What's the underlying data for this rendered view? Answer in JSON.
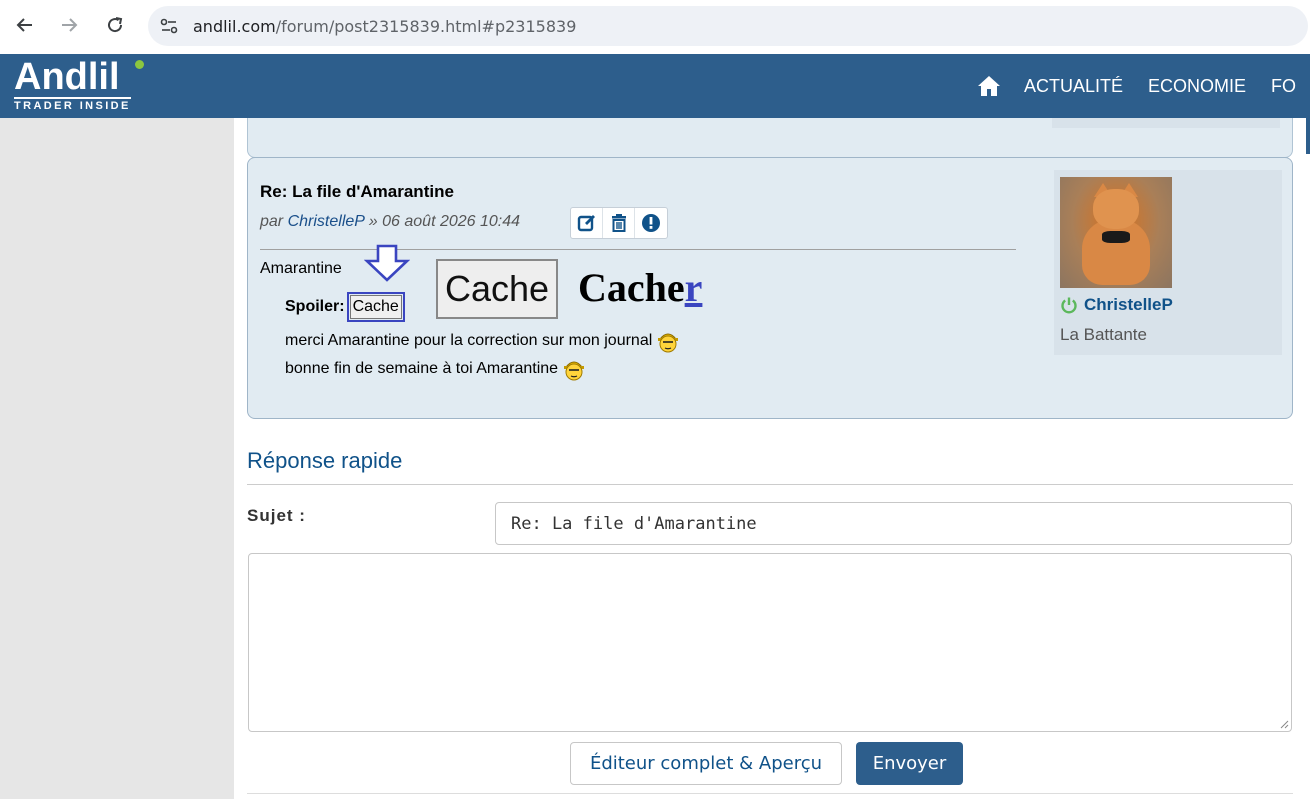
{
  "browser": {
    "url_host": "andlil.com",
    "url_path": "/forum/post2315839.html#p2315839"
  },
  "site": {
    "logo_main": "Andlil",
    "logo_sub": "TRADER INSIDE",
    "nav": [
      "ACTUALITÉ",
      "ECONOMIE",
      "FO"
    ]
  },
  "post": {
    "title": "Re: La file d'Amarantine",
    "meta_prefix": "par ",
    "author": "ChristelleP",
    "meta_date": " » 06 août 2026 10:44",
    "greeting": "Amarantine",
    "spoiler_label": "Spoiler:",
    "spoiler_button": "Cache",
    "big_button": "Cache",
    "serif_text": "Cache",
    "serif_last_letter": "r",
    "lines": [
      "merci Amarantine pour la correction sur mon journal",
      "bonne fin de semaine à toi Amarantine"
    ]
  },
  "profile": {
    "username": "ChristelleP",
    "rank": "La Battante"
  },
  "quick_reply": {
    "title": "Réponse rapide",
    "subject_label": "Sujet :",
    "subject_value": "Re: La file d'Amarantine",
    "message_value": "",
    "full_editor_label": "Éditeur complet & Aperçu",
    "send_label": "Envoyer"
  },
  "colors": {
    "header_bg": "#2d5e8c",
    "post_bg": "#e1ebf2",
    "link": "#105289",
    "annotation": "#3a45c0"
  }
}
